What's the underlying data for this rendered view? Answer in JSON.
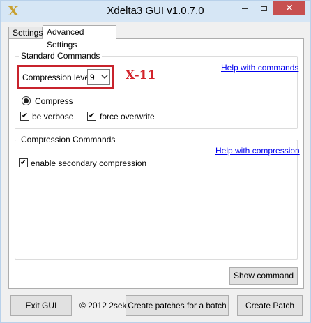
{
  "window": {
    "title": "Xdelta3 GUI v1.0.7.0",
    "icon_glyph": "X",
    "close_glyph": "✕"
  },
  "tabs": [
    {
      "label": "Settings"
    },
    {
      "label": "Advanced Settings"
    }
  ],
  "standard": {
    "legend": "Standard Commands",
    "help_link": "Help with commands",
    "compression_label": "Compression level:",
    "compression_value": "9",
    "annotation": "X-11",
    "compress_label": "Compress",
    "verbose_label": "be verbose",
    "overwrite_label": "force overwrite",
    "check_glyph": "✔"
  },
  "compression": {
    "legend": "Compression Commands",
    "help_link": "Help with compression",
    "secondary_label": "enable secondary compression"
  },
  "buttons": {
    "show_command": "Show command",
    "exit": "Exit GUI",
    "copyright": "© 2012 2sek",
    "batch": "Create patches for a batch",
    "create": "Create Patch"
  },
  "colors": {
    "highlight": "#c8232c",
    "link": "#0000ee",
    "close_button": "#c75050"
  }
}
